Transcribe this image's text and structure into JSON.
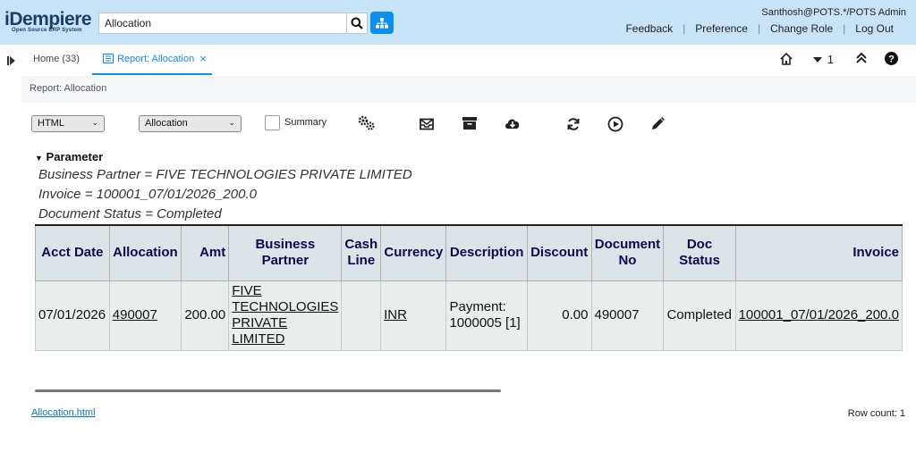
{
  "header": {
    "logo_main": "iDempiere",
    "logo_sub": "Open Source ERP System",
    "search_value": "Allocation",
    "user": "Santhosh@POTS.*/POTS Admin",
    "links": [
      "Feedback",
      "Preference",
      "Change Role",
      "Log Out"
    ]
  },
  "tabs": {
    "home": "Home (33)",
    "report": "Report: Allocation",
    "window_count": "1"
  },
  "breadcrumb": "Report: Allocation",
  "toolbar": {
    "format": "HTML",
    "print_format": "Allocation",
    "summary_label": "Summary"
  },
  "parameters": {
    "title": "Parameter",
    "lines": [
      "Business Partner  = FIVE TECHNOLOGIES PRIVATE LIMITED",
      "Invoice              = 100001_07/01/2026_200.0",
      "Document Status = Completed"
    ]
  },
  "table": {
    "headers": [
      "Acct Date",
      "Allocation",
      "Amt",
      "Business Partner",
      "Cash Line",
      "Currency",
      "Description",
      "Discount",
      "Document No",
      "Doc Status",
      "Invoice"
    ],
    "row": {
      "acct_date": "07/01/2026",
      "allocation": "490007",
      "amt": "200.00",
      "bp_1": "FIVE",
      "bp_2": "TECHNOLOGIES",
      "bp_3": "PRIVATE",
      "bp_4": "LIMITED",
      "cash_line": "",
      "currency": "INR",
      "desc_1": "Payment:",
      "desc_2": "1000005 [1]",
      "discount": "0.00",
      "document_no": "490007",
      "doc_status": "Completed",
      "invoice": "100001_07/01/2026_200.0"
    }
  },
  "footer": {
    "file_link": "Allocation.html",
    "row_count": "Row count: 1"
  },
  "colors": {
    "header_bg": "#c6e3f7",
    "accent": "#0d8ff0"
  }
}
